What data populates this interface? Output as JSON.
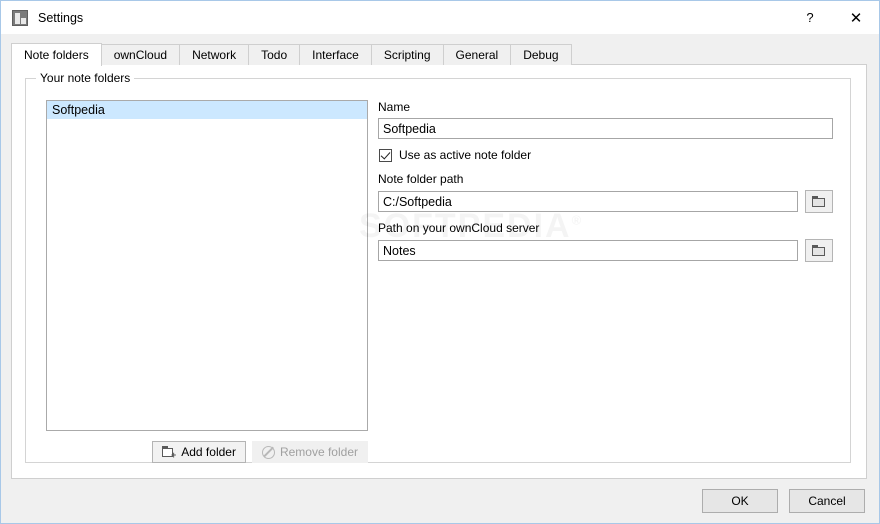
{
  "window": {
    "title": "Settings",
    "icon": "app-note-icon",
    "controls": {
      "help": "?",
      "close": "✕"
    }
  },
  "tabs": [
    {
      "label": "Note folders",
      "active": true
    },
    {
      "label": "ownCloud",
      "active": false
    },
    {
      "label": "Network",
      "active": false
    },
    {
      "label": "Todo",
      "active": false
    },
    {
      "label": "Interface",
      "active": false
    },
    {
      "label": "Scripting",
      "active": false
    },
    {
      "label": "General",
      "active": false
    },
    {
      "label": "Debug",
      "active": false
    }
  ],
  "group": {
    "title": "Your note folders",
    "list": {
      "items": [
        {
          "label": "Softpedia",
          "selected": true
        }
      ]
    },
    "buttons": {
      "add": "Add folder",
      "remove": "Remove folder",
      "remove_disabled": true
    }
  },
  "form": {
    "name": {
      "label": "Name",
      "value": "Softpedia"
    },
    "active_folder": {
      "label": "Use as active note folder",
      "checked": true
    },
    "note_folder_path": {
      "label": "Note folder path",
      "value": "C:/Softpedia",
      "browse": "folder-icon"
    },
    "owncloud_path": {
      "label": "Path on your ownCloud server",
      "value": "Notes",
      "browse": "folder-icon"
    }
  },
  "watermark": {
    "text": "SOFTPEDIA",
    "mark": "®"
  },
  "footer": {
    "ok": "OK",
    "cancel": "Cancel"
  },
  "colors": {
    "selection": "#cce8ff",
    "panel": "#ffffff",
    "chrome": "#f0f0f0",
    "border": "#cfcfcf"
  }
}
